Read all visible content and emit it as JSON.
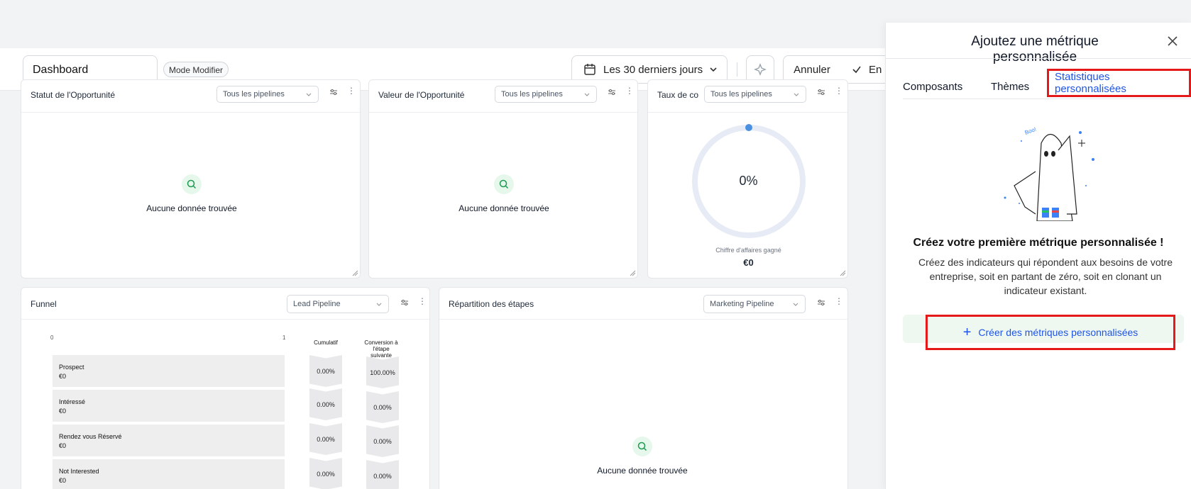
{
  "header": {
    "dashboard_name": "Dashboard",
    "mode_label": "Mode Modifier",
    "date_range": "Les 30 derniers jours",
    "cancel_label": "Annuler",
    "save_label": "En"
  },
  "cards": {
    "opportunity_status": {
      "title": "Statut de l'Opportunité",
      "select": "Tous les pipelines",
      "empty": "Aucune donnée trouvée"
    },
    "opportunity_value": {
      "title": "Valeur de l'Opportunité",
      "select": "Tous les pipelines",
      "empty": "Aucune donnée trouvée"
    },
    "conversion_rate": {
      "title": "Taux de co",
      "select": "Tous les pipelines",
      "gauge_percent": "0%",
      "gauge_fraction": 0,
      "subtitle": "Chiffre d'affaires gagné",
      "value": "€0"
    },
    "funnel": {
      "title": "Funnel",
      "select": "Lead Pipeline",
      "axis_min": "0",
      "axis_max": "1",
      "col_cumulative": "Cumulatif",
      "col_conversion": "Conversion à l'étape suivante",
      "rows": [
        {
          "name": "Prospect",
          "value": "€0",
          "cumulative": "0.00%",
          "conversion": "100.00%"
        },
        {
          "name": "Intéressé",
          "value": "€0",
          "cumulative": "0.00%",
          "conversion": "0.00%"
        },
        {
          "name": "Rendez vous Réservé",
          "value": "€0",
          "cumulative": "0.00%",
          "conversion": "0.00%"
        },
        {
          "name": "Not Interested",
          "value": "€0",
          "cumulative": "0.00%",
          "conversion": "0.00%"
        }
      ]
    },
    "stage_distribution": {
      "title": "Répartition des étapes",
      "select": "Marketing Pipeline",
      "empty": "Aucune donnée trouvée"
    }
  },
  "panel": {
    "title": "Ajoutez une métrique personnalisée",
    "tabs": [
      {
        "label": "Composants"
      },
      {
        "label": "Thèmes"
      },
      {
        "label": "Statistiques personnalisées"
      }
    ],
    "ghost_text": "Boo!",
    "empty_title": "Créez votre première métrique personnalisée !",
    "empty_desc": "Créez des indicateurs qui répondent aux besoins de votre entreprise, soit en partant de zéro, soit en clonant un indicateur existant.",
    "create_label": "Créer des métriques personnalisées"
  },
  "colors": {
    "accent": "#1f54e8",
    "highlight": "#e51919",
    "empty_green": "#e6f7ec",
    "gauge_track": "#e6ebf5",
    "gauge_dot": "#4a90e2"
  }
}
